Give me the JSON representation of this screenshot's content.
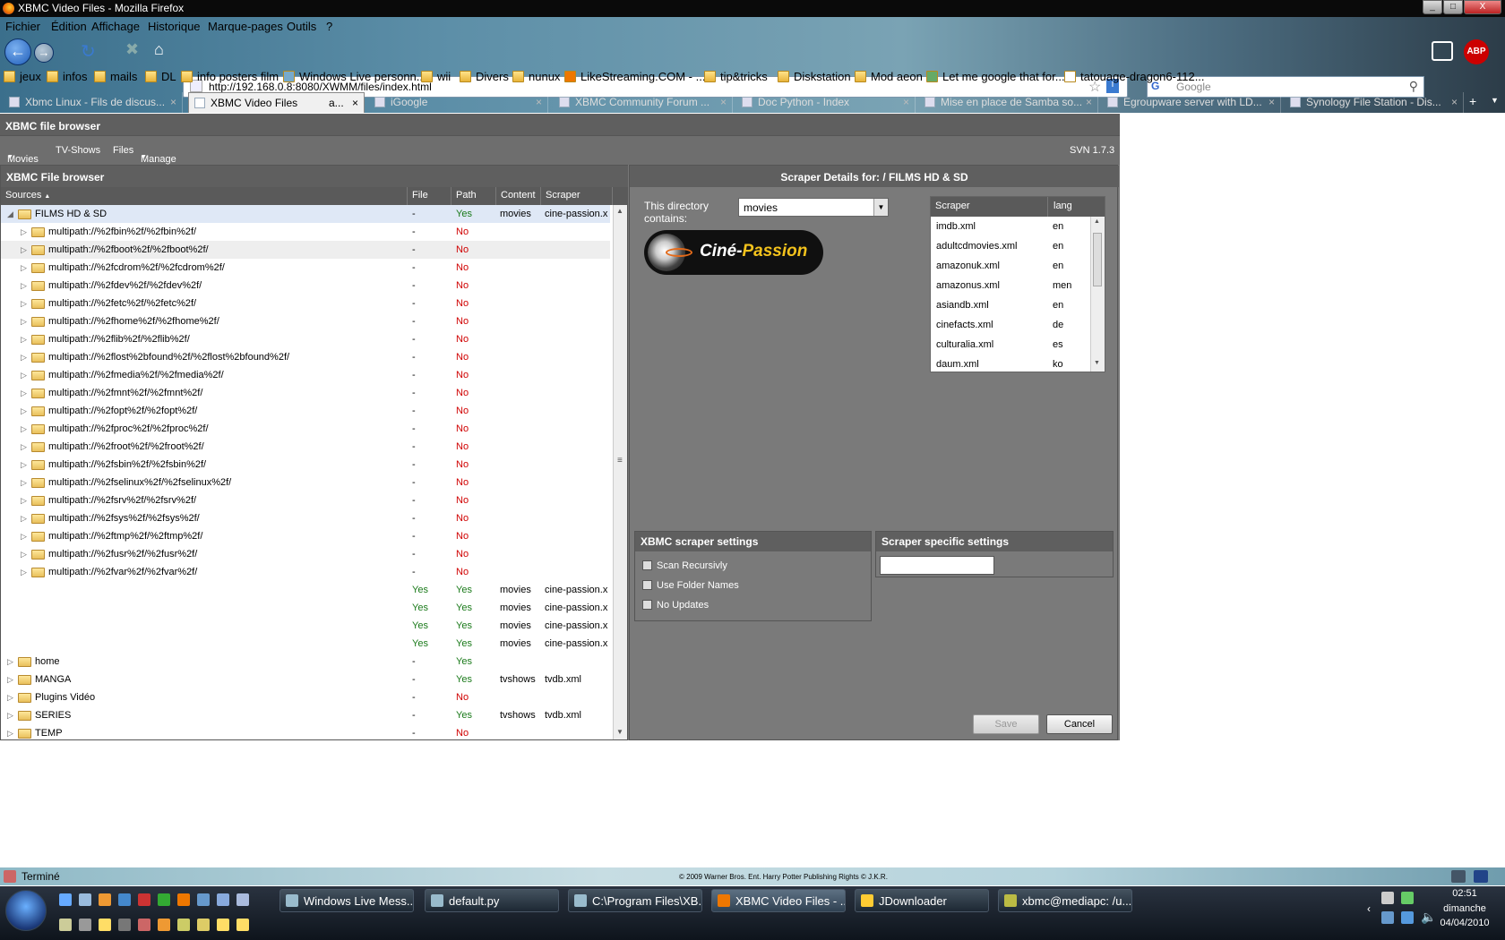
{
  "window": {
    "title": "XBMC Video Files - Mozilla Firefox",
    "min": "_",
    "max": "□",
    "close": "X"
  },
  "menubar": [
    "Fichier",
    "Édition",
    "Affichage",
    "Historique",
    "Marque-pages",
    "Outils",
    "?"
  ],
  "url": "http://192.168.0.8:8080/XWMM/files/index.html",
  "search_placeholder": "Google",
  "bookmarks": [
    "jeux",
    "infos",
    "mails",
    "DL",
    "info posters film",
    "Windows Live personn...",
    "wii",
    "Divers",
    "nunux",
    "LikeStreaming.COM - ...",
    "tip&tricks",
    "Diskstation",
    "Mod aeon",
    "Let me google that for...",
    "tatouage-dragon6-112..."
  ],
  "tabs": [
    {
      "label": "Xbmc Linux - Fils de discus..."
    },
    {
      "label": "XBMC Video Files",
      "badge": "a...",
      "active": true
    },
    {
      "label": "iGoogle"
    },
    {
      "label": "XBMC Community Forum ..."
    },
    {
      "label": "Doc Python - Index"
    },
    {
      "label": "Mise en place de Samba so..."
    },
    {
      "label": "Egroupware server with LD..."
    },
    {
      "label": "Synology File Station - Dis..."
    }
  ],
  "app": {
    "title": "XBMC file browser",
    "menu": [
      "Movies",
      "TV-Shows",
      "Files",
      "Manage"
    ],
    "version": "SVN 1.7.3"
  },
  "browser": {
    "title": "XBMC File browser",
    "columns": [
      "Sources",
      "File",
      "Path",
      "Content",
      "Scraper"
    ],
    "rows": [
      {
        "level": 0,
        "expanded": true,
        "name": "FILMS HD & SD",
        "file": "-",
        "path": "Yes",
        "content": "movies",
        "scraper": "cine-passion.x",
        "selected": true
      },
      {
        "level": 1,
        "name": "multipath://%2fbin%2f/%2fbin%2f/",
        "file": "-",
        "path": "No"
      },
      {
        "level": 1,
        "name": "multipath://%2fboot%2f/%2fboot%2f/",
        "file": "-",
        "path": "No",
        "hover": true
      },
      {
        "level": 1,
        "name": "multipath://%2fcdrom%2f/%2fcdrom%2f/",
        "file": "-",
        "path": "No"
      },
      {
        "level": 1,
        "name": "multipath://%2fdev%2f/%2fdev%2f/",
        "file": "-",
        "path": "No"
      },
      {
        "level": 1,
        "name": "multipath://%2fetc%2f/%2fetc%2f/",
        "file": "-",
        "path": "No"
      },
      {
        "level": 1,
        "name": "multipath://%2fhome%2f/%2fhome%2f/",
        "file": "-",
        "path": "No"
      },
      {
        "level": 1,
        "name": "multipath://%2flib%2f/%2flib%2f/",
        "file": "-",
        "path": "No"
      },
      {
        "level": 1,
        "name": "multipath://%2flost%2bfound%2f/%2flost%2bfound%2f/",
        "file": "-",
        "path": "No"
      },
      {
        "level": 1,
        "name": "multipath://%2fmedia%2f/%2fmedia%2f/",
        "file": "-",
        "path": "No"
      },
      {
        "level": 1,
        "name": "multipath://%2fmnt%2f/%2fmnt%2f/",
        "file": "-",
        "path": "No"
      },
      {
        "level": 1,
        "name": "multipath://%2fopt%2f/%2fopt%2f/",
        "file": "-",
        "path": "No"
      },
      {
        "level": 1,
        "name": "multipath://%2fproc%2f/%2fproc%2f/",
        "file": "-",
        "path": "No"
      },
      {
        "level": 1,
        "name": "multipath://%2froot%2f/%2froot%2f/",
        "file": "-",
        "path": "No"
      },
      {
        "level": 1,
        "name": "multipath://%2fsbin%2f/%2fsbin%2f/",
        "file": "-",
        "path": "No"
      },
      {
        "level": 1,
        "name": "multipath://%2fselinux%2f/%2fselinux%2f/",
        "file": "-",
        "path": "No"
      },
      {
        "level": 1,
        "name": "multipath://%2fsrv%2f/%2fsrv%2f/",
        "file": "-",
        "path": "No"
      },
      {
        "level": 1,
        "name": "multipath://%2fsys%2f/%2fsys%2f/",
        "file": "-",
        "path": "No"
      },
      {
        "level": 1,
        "name": "multipath://%2ftmp%2f/%2ftmp%2f/",
        "file": "-",
        "path": "No"
      },
      {
        "level": 1,
        "name": "multipath://%2fusr%2f/%2fusr%2f/",
        "file": "-",
        "path": "No"
      },
      {
        "level": 1,
        "name": "multipath://%2fvar%2f/%2fvar%2f/",
        "file": "-",
        "path": "No"
      },
      {
        "level": -1,
        "name": "",
        "file": "Yes",
        "path": "Yes",
        "content": "movies",
        "scraper": "cine-passion.x"
      },
      {
        "level": -1,
        "name": "",
        "file": "Yes",
        "path": "Yes",
        "content": "movies",
        "scraper": "cine-passion.x"
      },
      {
        "level": -1,
        "name": "",
        "file": "Yes",
        "path": "Yes",
        "content": "movies",
        "scraper": "cine-passion.x"
      },
      {
        "level": -1,
        "name": "",
        "file": "Yes",
        "path": "Yes",
        "content": "movies",
        "scraper": "cine-passion.x"
      },
      {
        "level": 0,
        "name": "home",
        "file": "-",
        "path": "Yes"
      },
      {
        "level": 0,
        "name": "MANGA",
        "file": "-",
        "path": "Yes",
        "content": "tvshows",
        "scraper": "tvdb.xml"
      },
      {
        "level": 0,
        "name": "Plugins Vidéo",
        "file": "-",
        "path": "No"
      },
      {
        "level": 0,
        "name": "SERIES",
        "file": "-",
        "path": "Yes",
        "content": "tvshows",
        "scraper": "tvdb.xml"
      },
      {
        "level": 0,
        "name": "TEMP",
        "file": "-",
        "path": "No"
      }
    ]
  },
  "details": {
    "title": "Scraper Details for: / FILMS HD & SD",
    "contains_label": "This directory contains:",
    "contains_value": "movies",
    "logo_text_a": "Ciné-",
    "logo_text_b": "Passion",
    "scraper_cols": [
      "Scraper",
      "lang"
    ],
    "scrapers": [
      {
        "name": "imdb.xml",
        "lang": "en"
      },
      {
        "name": "adultcdmovies.xml",
        "lang": "en"
      },
      {
        "name": "amazonuk.xml",
        "lang": "en"
      },
      {
        "name": "amazonus.xml",
        "lang": "men"
      },
      {
        "name": "asiandb.xml",
        "lang": "en"
      },
      {
        "name": "cinefacts.xml",
        "lang": "de"
      },
      {
        "name": "culturalia.xml",
        "lang": "es"
      },
      {
        "name": "daum.xml",
        "lang": "ko"
      }
    ],
    "xbmc_settings_title": "XBMC scraper settings",
    "checkboxes": [
      "Scan Recursivly",
      "Use Folder Names",
      "No Updates"
    ],
    "specific_title": "Scraper specific settings",
    "save": "Save",
    "cancel": "Cancel"
  },
  "status": {
    "text": "Terminé",
    "copyright": "© 2009 Warner Bros. Ent. Harry Potter Publishing Rights © J.K.R."
  },
  "taskbar": {
    "items": [
      "Windows Live Mess...",
      "default.py",
      "C:\\Program Files\\XB...",
      "XBMC Video Files - ...",
      "JDownloader",
      "xbmc@mediapc: /u..."
    ],
    "time": "02:51",
    "day": "dimanche",
    "date": "04/04/2010"
  }
}
